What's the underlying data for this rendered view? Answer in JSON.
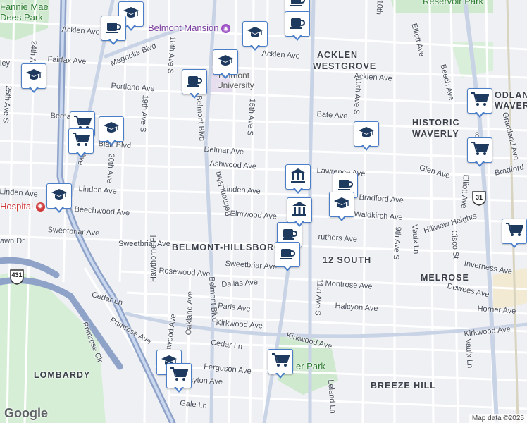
{
  "map": {
    "neighborhoods": [
      {
        "label": "ACKLEN WESTGROVE",
        "lines": [
          "ACKLEN",
          "WESTGROVE"
        ],
        "id": "hood-acklen-westgrove"
      },
      {
        "label": "HISTORIC WAVERLY",
        "lines": [
          "HISTORIC",
          "WAVERLY"
        ],
        "id": "hood-historic-waverly"
      },
      {
        "label": "BELMONT-HILLSBORO",
        "lines": [
          "BELMONT-HILLSBORO"
        ],
        "id": "hood-belmont-hillsboro"
      },
      {
        "label": "12 SOUTH",
        "lines": [
          "12 SOUTH"
        ],
        "id": "hood-12-south"
      },
      {
        "label": "MELROSE",
        "lines": [
          "MELROSE"
        ],
        "id": "hood-melrose"
      },
      {
        "label": "LOMBARDY",
        "lines": [
          "LOMBARDY"
        ],
        "id": "hood-lombardy"
      },
      {
        "label": "BREEZE HILL",
        "lines": [
          "BREEZE HILL"
        ],
        "id": "hood-breeze-hill"
      },
      {
        "label": "ODLAN",
        "lines": [
          "ODLAN"
        ],
        "id": "hood-odlan"
      },
      {
        "label": "WAVERLY",
        "lines": [
          "WAVERLY"
        ],
        "id": "hood-waverly-edge"
      }
    ],
    "places": {
      "fannie_mae_dees_park_line1": "Fannie Mae",
      "fannie_mae_dees_park_line2": "Dees Park",
      "belmont_mansion": "Belmont Mansion",
      "belmont_university_line1": "Belmont",
      "belmont_university_line2": "University",
      "hospital": "Hospital",
      "park_bottom": "er Park",
      "reservoir_park": "Reservoir Park"
    },
    "streets": {
      "acklen_ave_w": "Acklen Ave",
      "acklen_ave_mid": "Acklen Ave",
      "acklen_ave_e": "Acklen Ave",
      "magnolia_blvd": "Magnolia Blvd",
      "fairfax_ave": "Fairfax Ave",
      "portland_ave": "Portland Ave",
      "bate_ave": "Bate Ave",
      "bernard": "Berna",
      "blair_blvd": "Blair Blvd",
      "delmar_ave": "Delmar Ave",
      "ashwood_ave": "Ashwood Ave",
      "lawrence_ave": "Lawrence Ave",
      "glen_ave": "Glen Ave",
      "bradford_ave_e": "Bradford",
      "bradford_ave": "Bradford Ave",
      "linden_ave_w": "Linden Ave",
      "linden_ave_mid": "Linden Ave",
      "beechwood_ave": "Beechwood Ave",
      "elmwood_ave": "Elmwood Ave",
      "waldkirch_ave": "Waldkirch Ave",
      "sweetbriar_ave_w": "Sweetbriar Ave",
      "sweetbriar_ave_mid": "Sweetbriar Ave",
      "sweetbriar_ave_e": "Sweetbriar Ave",
      "caruthers_ave": "ruthers Ave",
      "hillview_heights": "Hillview Heights",
      "rosewood_ave": "Rosewood Ave",
      "dallas_ave": "Dallas Ave",
      "montrose_ave": "Montrose Ave",
      "inverness_ave": "Inverness Ave",
      "dewees_ave": "Dewees Ave",
      "paris_ave": "Paris Ave",
      "halcyon_ave": "Halcyon Ave",
      "horner_ave": "Horner Ave",
      "cedar_ln_w": "Cedar Ln",
      "cedar_ln_mid": "Cedar Ln",
      "kirkwood_ave_w": "Kirkwood Ave",
      "kirkwood_ave_mid": "Kirkwood Ave",
      "kirkwood_ave_e": "Kirkwood Ave",
      "primrose_ave": "Primrose Ave",
      "primrose_cir": "Primrose Cir",
      "ferguson_ave": "Ferguson Ave",
      "clayton_ave": "Clayton Ave",
      "gale_ln": "Gale Ln",
      "lawn_dr": "awn Dr",
      "belmont_blvd_n": "Belmont Blvd",
      "belmont_blvd_mid": "Belmont Blvd",
      "belmont_blvd_s": "Belmont Blvd",
      "hawthorne_pl": "Hawthorne Pl",
      "brightwood_ave": "Brightwood Ave",
      "oakland_ave": "Oakland Ave",
      "s_25th": "25th Ave S",
      "s_24th": "24th Ave S",
      "s_21st": "21st Ave",
      "s_20th": "20th Ave",
      "s_19th": "19th Ave S",
      "s_18th": "18th Ave S",
      "s_15th": "15th Ave S",
      "s_11th": "11th Ave S",
      "s_10th": "10th Ave S",
      "s_10th_n": "10th",
      "s_9th": "9th Ave S",
      "elliott_ave_n": "Elliott Ave",
      "elliott_ave_s": "Elliott Ave",
      "beech_ave": "Beech Ave",
      "grantland_ave": "Grantland Ave",
      "vaulx_ln": "Vaulx Ln",
      "vaulx_ln_s": "Vaulx Ln",
      "cisco_st": "Cisco St",
      "leland_ln": "Leland Ln",
      "s_8th": "8",
      "ley": "ley"
    },
    "route_shields": {
      "us_431": "431",
      "us_31": "31"
    },
    "attribution": "Map data ©2025",
    "logo": "Google",
    "colors": {
      "marker_border": "#4a7ec9",
      "icon": "#1f3a5f",
      "hospital": "#d03a3a",
      "poi": "#7a3e9d",
      "road_major": "#8fa3c8",
      "highway": "#6c7f9f"
    }
  },
  "markers": [
    {
      "type": "school",
      "icon": "graduation-cap-icon"
    },
    {
      "type": "school",
      "icon": "graduation-cap-icon"
    },
    {
      "type": "cafe",
      "icon": "coffee-cup-icon"
    },
    {
      "type": "cafe",
      "icon": "coffee-cup-icon"
    },
    {
      "type": "school",
      "icon": "graduation-cap-icon"
    },
    {
      "type": "school",
      "icon": "graduation-cap-icon"
    },
    {
      "type": "cafe",
      "icon": "coffee-cup-icon"
    },
    {
      "type": "cafe",
      "icon": "coffee-cup-icon"
    },
    {
      "type": "school",
      "icon": "graduation-cap-icon"
    },
    {
      "type": "grocery",
      "icon": "shopping-cart-icon"
    },
    {
      "type": "grocery",
      "icon": "shopping-cart-icon"
    },
    {
      "type": "school",
      "icon": "graduation-cap-icon"
    },
    {
      "type": "school",
      "icon": "graduation-cap-icon"
    },
    {
      "type": "grocery",
      "icon": "shopping-cart-icon"
    },
    {
      "type": "grocery",
      "icon": "shopping-cart-icon"
    },
    {
      "type": "grocery",
      "icon": "shopping-cart-icon"
    },
    {
      "type": "cafe",
      "icon": "coffee-cup-icon"
    },
    {
      "type": "school",
      "icon": "graduation-cap-icon"
    },
    {
      "type": "bank",
      "icon": "bank-icon"
    },
    {
      "type": "cafe",
      "icon": "coffee-cup-icon"
    },
    {
      "type": "bank",
      "icon": "bank-icon"
    },
    {
      "type": "cafe",
      "icon": "coffee-cup-icon"
    },
    {
      "type": "school",
      "icon": "graduation-cap-icon"
    },
    {
      "type": "grocery",
      "icon": "shopping-cart-icon"
    },
    {
      "type": "grocery",
      "icon": "shopping-cart-icon"
    }
  ]
}
